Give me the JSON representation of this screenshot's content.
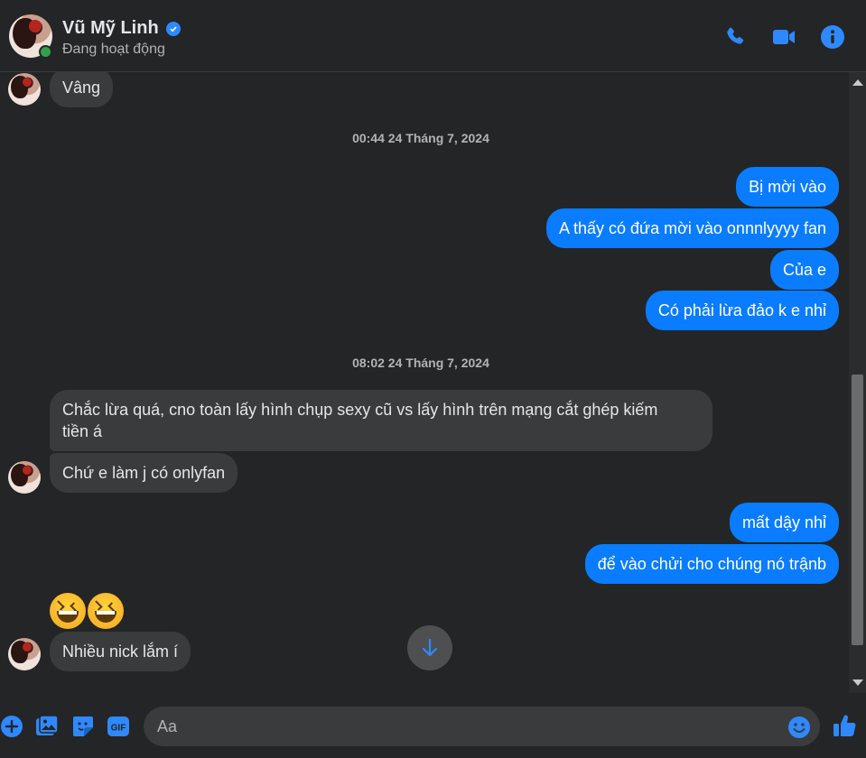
{
  "header": {
    "name": "Vũ Mỹ Linh",
    "status": "Đang hoạt động",
    "icons": [
      "phone-icon",
      "video-icon",
      "info-icon"
    ]
  },
  "timestamps": [
    "00:44 24 Tháng 7, 2024",
    "08:02 24 Tháng 7, 2024"
  ],
  "messages": {
    "m0": "Vâng",
    "m1": "Bị mời vào",
    "m2": "A thấy có đứa mời vào onnnlyyyy fan",
    "m3": "Của e",
    "m4": "Có phải lừa đảo k e nhỉ",
    "m5_line1": "Chắc lừa quá, cno toàn lấy hình chụp sexy cũ vs lấy hình trên mạng cắt ghép kiếm",
    "m5_line2": "tiền á",
    "m6": "Chứ e làm j có onlyfan",
    "m7": "mất dậy nhỉ",
    "m8": "để vào chửi cho chúng nó trậnb",
    "m9_emoji": [
      "grinning-squinting-face",
      "grinning-squinting-face"
    ],
    "m10": "Nhiều nick lắm í"
  },
  "composer": {
    "placeholder": "Aa",
    "value": "",
    "icons": [
      "plus-icon",
      "image-icon",
      "sticker-icon",
      "gif-icon",
      "emoji-icon",
      "thumbs-up-icon"
    ],
    "gif_label": "GIF"
  },
  "colors": {
    "accent": "#0a7cff",
    "icon_blue": "#2e89ff",
    "background": "#242526",
    "incoming_bubble": "#3a3b3c",
    "online": "#31a24c"
  }
}
